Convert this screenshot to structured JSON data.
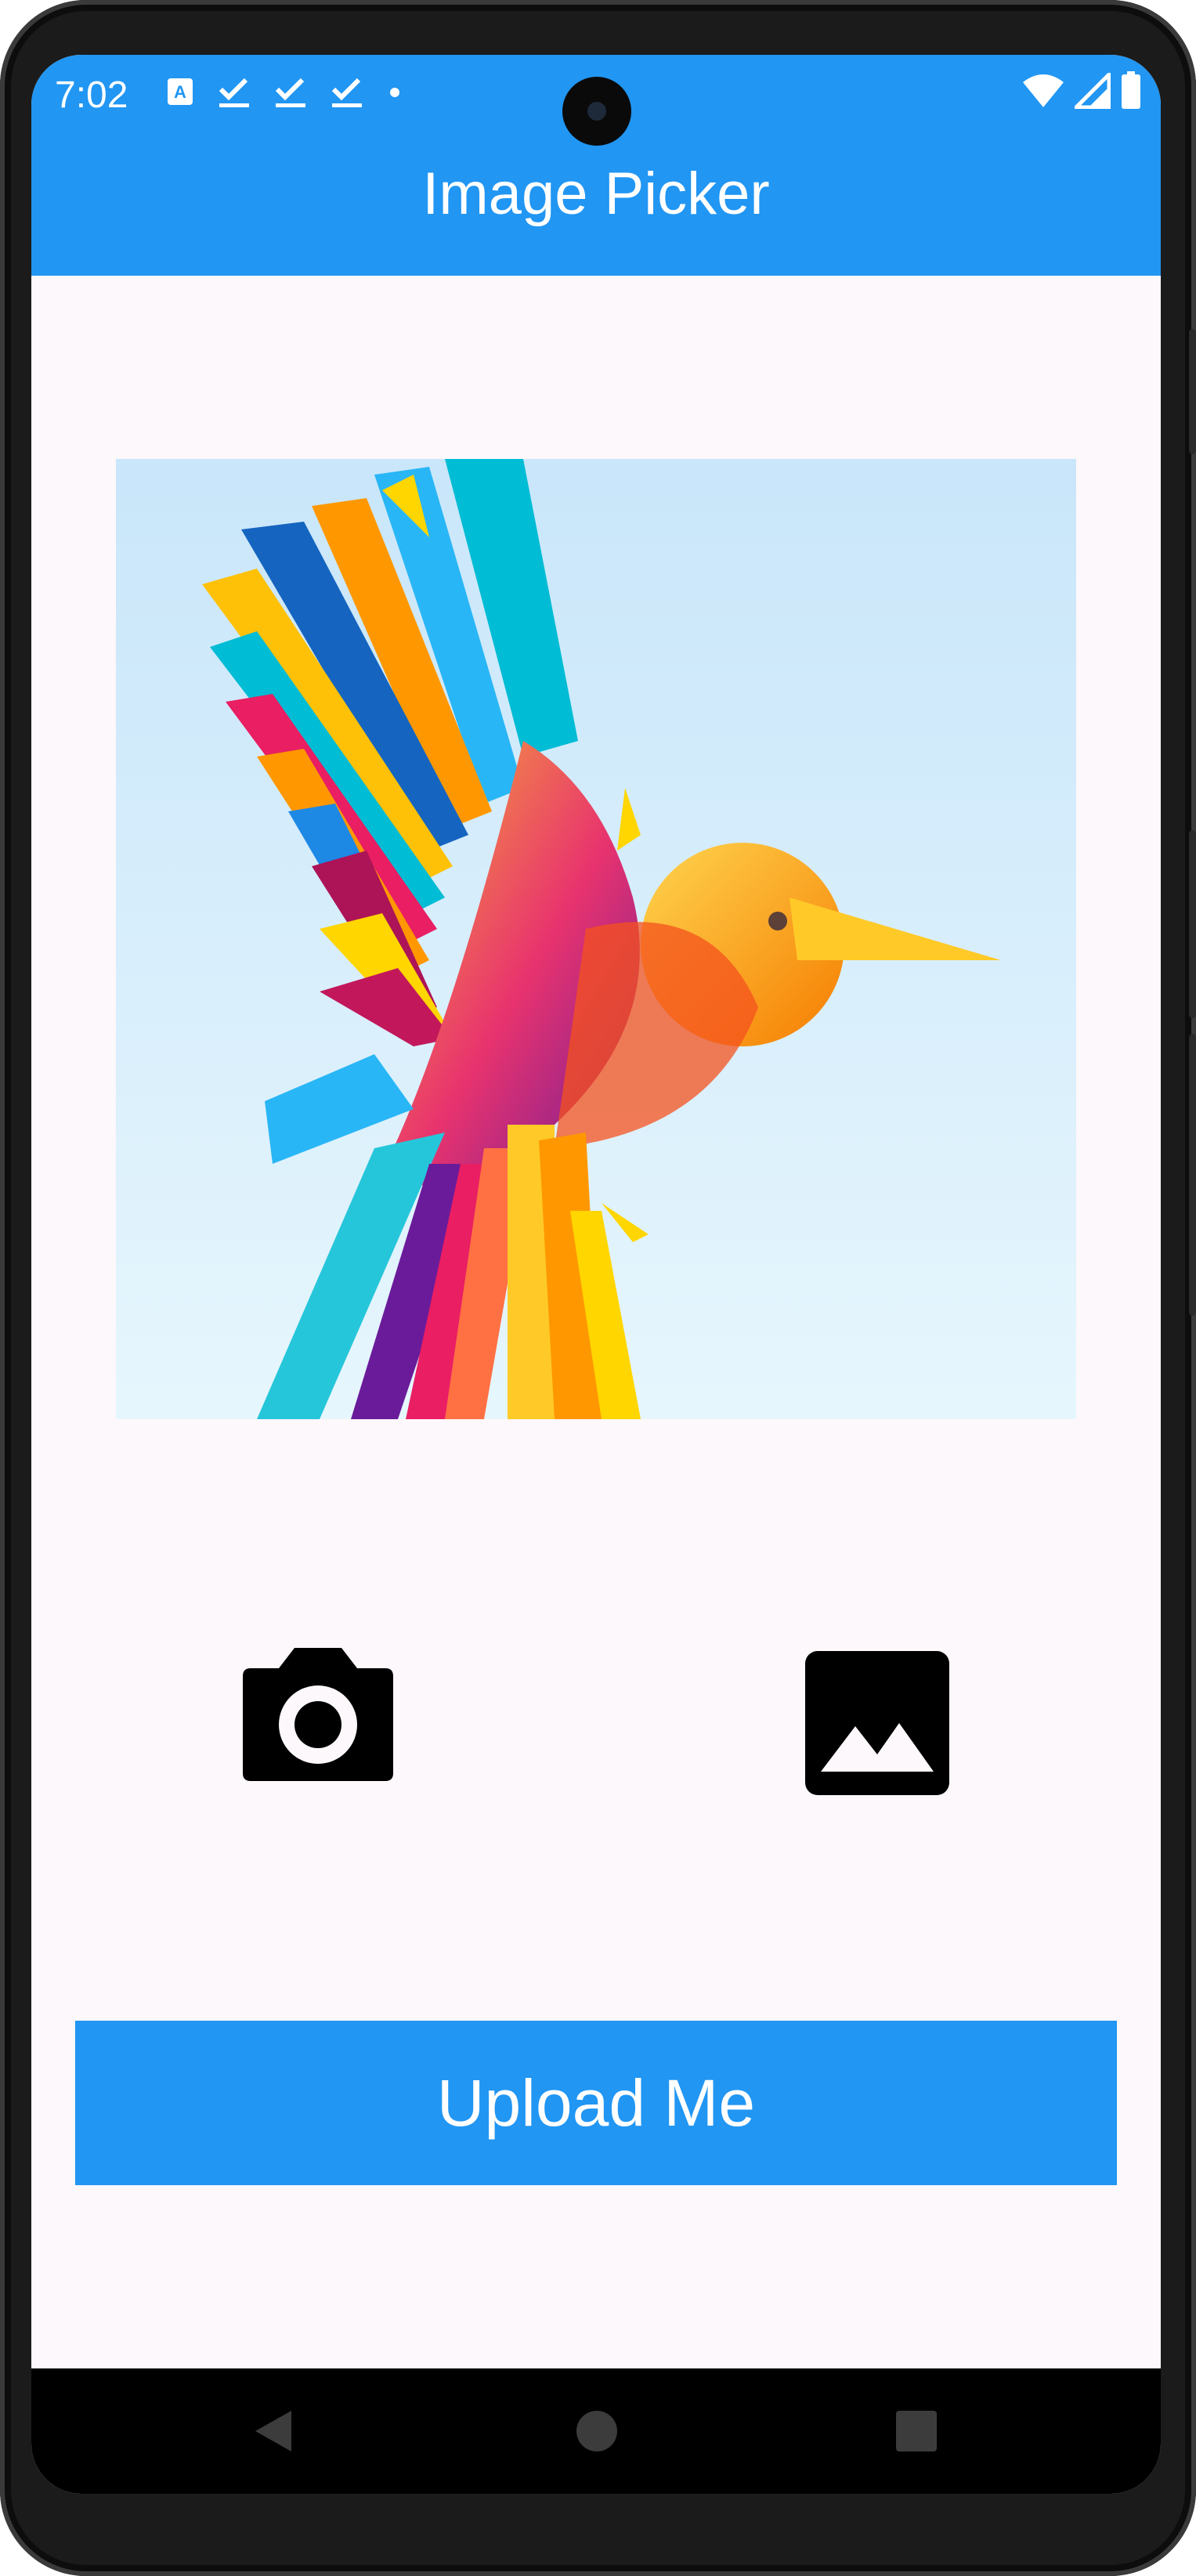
{
  "status_bar": {
    "time": "7:02",
    "left_icons": [
      "text-format-icon",
      "check-icon",
      "check-icon",
      "check-icon",
      "dot-icon"
    ],
    "right_icons": [
      "wifi-icon",
      "cell-signal-icon",
      "battery-icon"
    ]
  },
  "app_bar": {
    "title": "Image Picker",
    "color": "#2196f3"
  },
  "picked_image": {
    "subject_icon": "hummingbird-illustration",
    "background": "#d0e9fb"
  },
  "actions": {
    "camera_icon": "camera-icon",
    "gallery_icon": "gallery-icon"
  },
  "upload_button": {
    "label": "Upload Me",
    "color": "#2196f3"
  },
  "nav_bar": {
    "items": [
      "back-icon",
      "home-icon",
      "recents-icon"
    ]
  }
}
